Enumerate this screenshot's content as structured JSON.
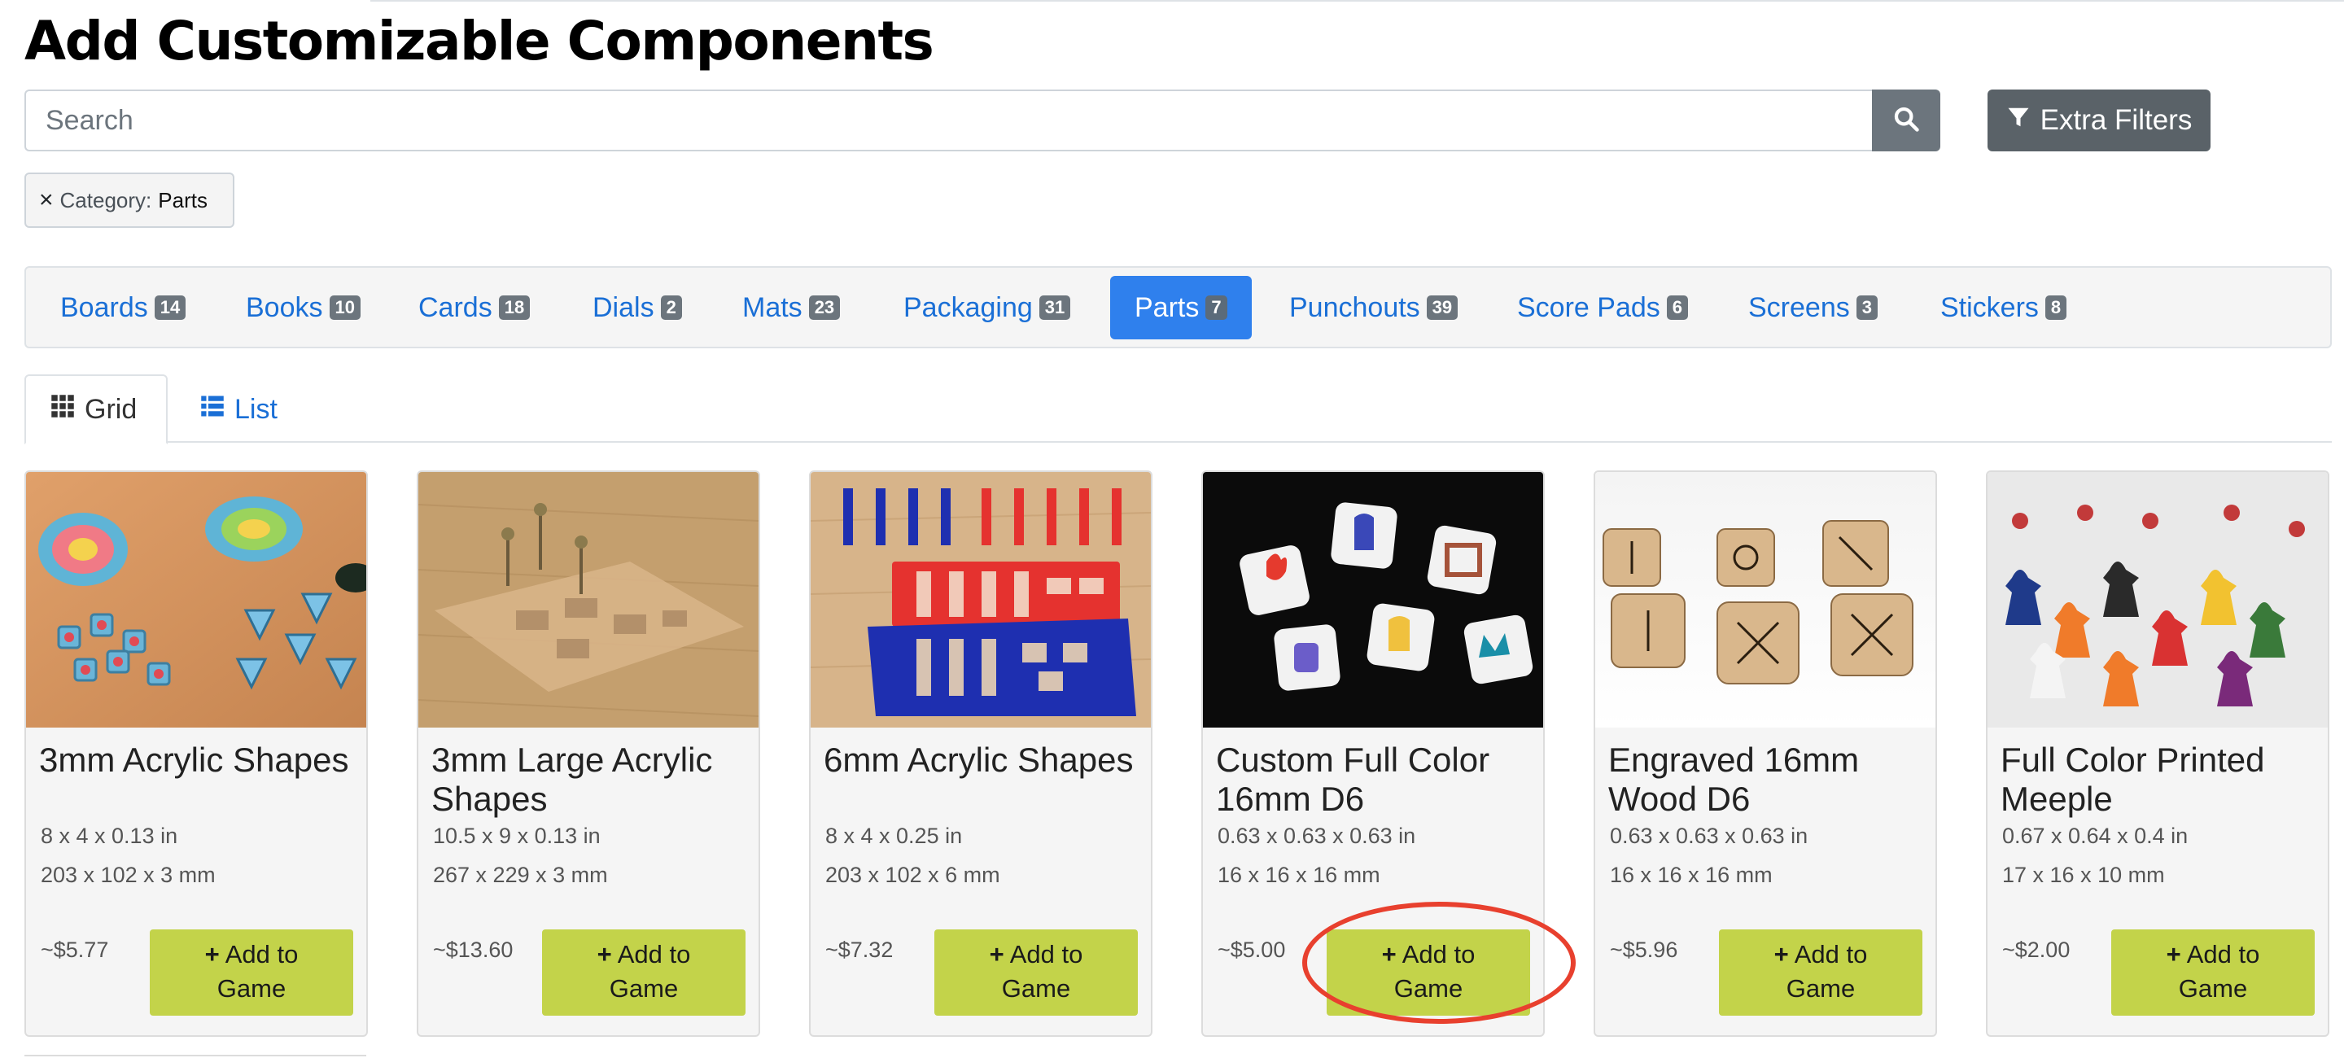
{
  "page": {
    "title": "Add Customizable Components"
  },
  "search": {
    "placeholder": "Search",
    "value": "",
    "button_icon": "search-icon"
  },
  "filters_button": {
    "label": "Extra Filters",
    "icon": "filter-icon"
  },
  "active_filter": {
    "remove_symbol": "×",
    "label": "Category:",
    "value": "Parts"
  },
  "categories": [
    {
      "label": "Boards",
      "count": "14",
      "active": false
    },
    {
      "label": "Books",
      "count": "10",
      "active": false
    },
    {
      "label": "Cards",
      "count": "18",
      "active": false
    },
    {
      "label": "Dials",
      "count": "2",
      "active": false
    },
    {
      "label": "Mats",
      "count": "23",
      "active": false
    },
    {
      "label": "Packaging",
      "count": "31",
      "active": false
    },
    {
      "label": "Parts",
      "count": "7",
      "active": true
    },
    {
      "label": "Punchouts",
      "count": "39",
      "active": false
    },
    {
      "label": "Score Pads",
      "count": "6",
      "active": false
    },
    {
      "label": "Screens",
      "count": "3",
      "active": false
    },
    {
      "label": "Stickers",
      "count": "8",
      "active": false
    }
  ],
  "view_tabs": [
    {
      "label": "Grid",
      "icon": "grid-icon",
      "active": true
    },
    {
      "label": "List",
      "icon": "list-icon",
      "active": false
    }
  ],
  "products": [
    {
      "name": "3mm Acrylic Shapes",
      "dims_in": "8 x 4 x 0.13 in",
      "dims_mm": "203 x 102 x 3 mm",
      "price": "~$5.77",
      "add_label_1": "Add to",
      "add_label_2": "Game",
      "image": "acrylic-tokens-photo"
    },
    {
      "name": "3mm Large Acrylic Shapes",
      "dims_in": "10.5 x 9 x 0.13 in",
      "dims_mm": "267 x 229 x 3 mm",
      "price": "~$13.60",
      "add_label_1": "Add to",
      "add_label_2": "Game",
      "image": "acrylic-sheet-photo"
    },
    {
      "name": "6mm Acrylic Shapes",
      "dims_in": "8 x 4 x 0.25 in",
      "dims_mm": "203 x 102 x 6 mm",
      "price": "~$7.32",
      "add_label_1": "Add to",
      "add_label_2": "Game",
      "image": "acrylic-standees-photo"
    },
    {
      "name": "Custom Full Color 16mm D6",
      "dims_in": "0.63 x 0.63 x 0.63 in",
      "dims_mm": "16 x 16 x 16 mm",
      "price": "~$5.00",
      "add_label_1": "Add to",
      "add_label_2": "Game",
      "image": "color-dice-photo"
    },
    {
      "name": "Engraved 16mm Wood D6",
      "dims_in": "0.63 x 0.63 x 0.63 in",
      "dims_mm": "16 x 16 x 16 mm",
      "price": "~$5.96",
      "add_label_1": "Add to",
      "add_label_2": "Game",
      "image": "wood-dice-photo"
    },
    {
      "name": "Full Color Printed Meeple",
      "dims_in": "0.67 x 0.64 x 0.4 in",
      "dims_mm": "17 x 16 x 10 mm",
      "price": "~$2.00",
      "add_label_1": "Add to",
      "add_label_2": "Game",
      "image": "meeples-photo"
    }
  ],
  "colors": {
    "accent": "#2f80ed",
    "link": "#1a6fd6",
    "add_button": "#c3d34a",
    "highlight_ring": "#e8402e"
  }
}
